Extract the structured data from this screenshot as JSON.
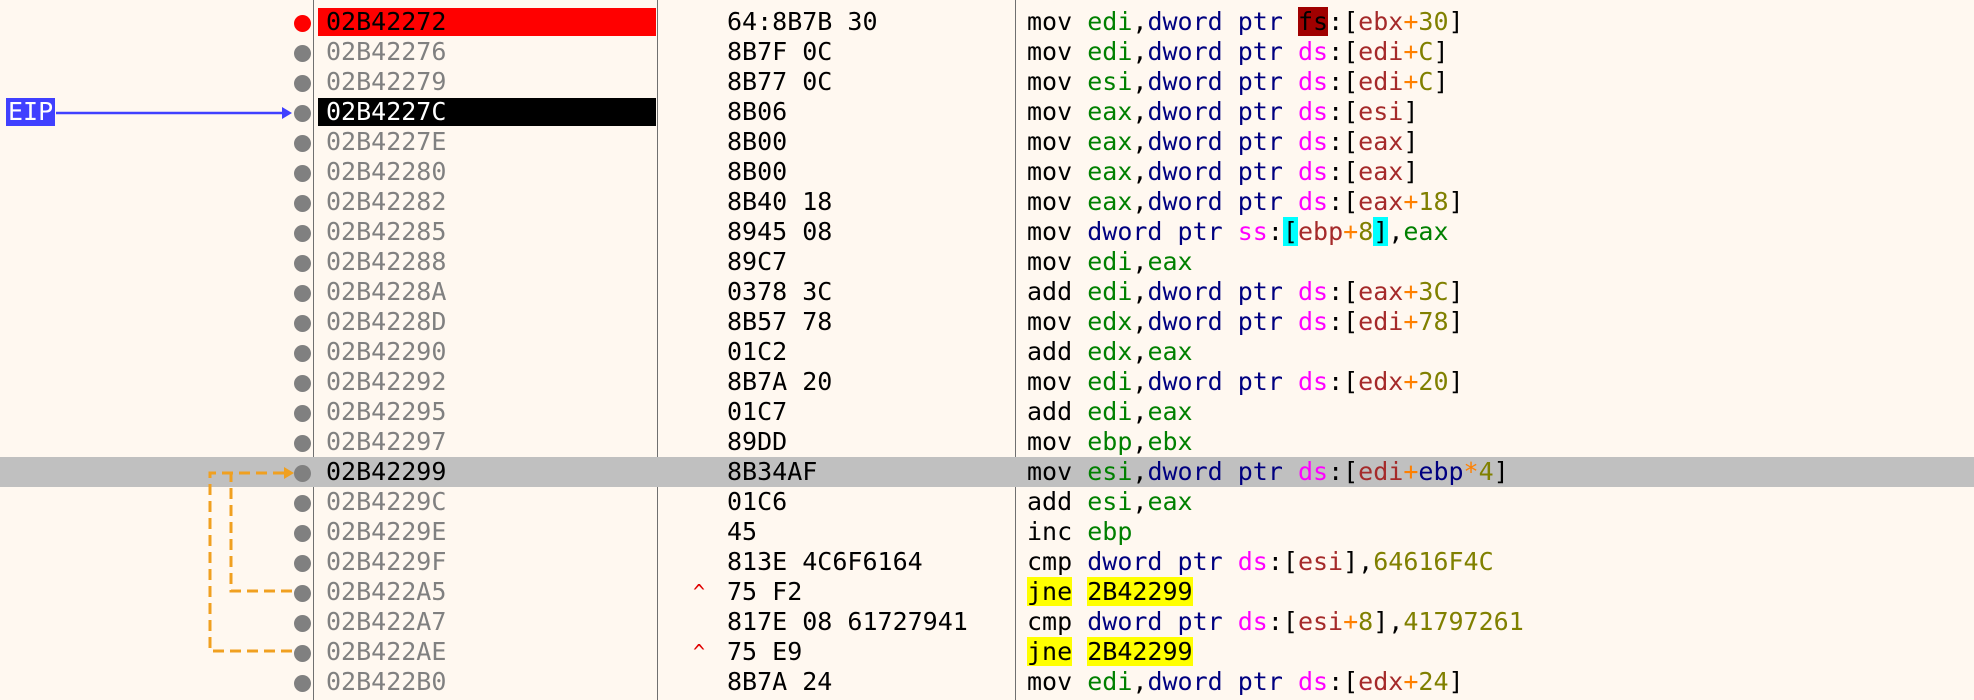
{
  "eip": {
    "label": "EIP"
  },
  "rows": [
    {
      "addr": "02B42272",
      "bytes": "64:8B7B 30",
      "state": "breakpoint",
      "instr": [
        [
          "mn",
          "mov "
        ],
        [
          "reg",
          "edi"
        ],
        [
          "br",
          ","
        ],
        [
          "kw",
          "dword ptr "
        ],
        [
          "seg",
          "fs",
          "rb"
        ],
        [
          "br",
          ":["
        ],
        [
          "mreg",
          "ebx"
        ],
        [
          "op",
          "+"
        ],
        [
          "imm",
          "30"
        ],
        [
          "br",
          "]"
        ]
      ]
    },
    {
      "addr": "02B42276",
      "bytes": "8B7F 0C",
      "instr": [
        [
          "mn",
          "mov "
        ],
        [
          "reg",
          "edi"
        ],
        [
          "br",
          ","
        ],
        [
          "kw",
          "dword ptr "
        ],
        [
          "seg",
          "ds"
        ],
        [
          "br",
          ":["
        ],
        [
          "mreg",
          "edi"
        ],
        [
          "op",
          "+"
        ],
        [
          "imm",
          "C"
        ],
        [
          "br",
          "]"
        ]
      ]
    },
    {
      "addr": "02B42279",
      "bytes": "8B77 0C",
      "instr": [
        [
          "mn",
          "mov "
        ],
        [
          "reg",
          "esi"
        ],
        [
          "br",
          ","
        ],
        [
          "kw",
          "dword ptr "
        ],
        [
          "seg",
          "ds"
        ],
        [
          "br",
          ":["
        ],
        [
          "mreg",
          "edi"
        ],
        [
          "op",
          "+"
        ],
        [
          "imm",
          "C"
        ],
        [
          "br",
          "]"
        ]
      ]
    },
    {
      "addr": "02B4227C",
      "bytes": "8B06",
      "state": "eip",
      "instr": [
        [
          "mn",
          "mov "
        ],
        [
          "reg",
          "eax"
        ],
        [
          "br",
          ","
        ],
        [
          "kw",
          "dword ptr "
        ],
        [
          "seg",
          "ds"
        ],
        [
          "br",
          ":["
        ],
        [
          "mreg",
          "esi"
        ],
        [
          "br",
          "]"
        ]
      ]
    },
    {
      "addr": "02B4227E",
      "bytes": "8B00",
      "instr": [
        [
          "mn",
          "mov "
        ],
        [
          "reg",
          "eax"
        ],
        [
          "br",
          ","
        ],
        [
          "kw",
          "dword ptr "
        ],
        [
          "seg",
          "ds"
        ],
        [
          "br",
          ":["
        ],
        [
          "mreg",
          "eax"
        ],
        [
          "br",
          "]"
        ]
      ]
    },
    {
      "addr": "02B42280",
      "bytes": "8B00",
      "instr": [
        [
          "mn",
          "mov "
        ],
        [
          "reg",
          "eax"
        ],
        [
          "br",
          ","
        ],
        [
          "kw",
          "dword ptr "
        ],
        [
          "seg",
          "ds"
        ],
        [
          "br",
          ":["
        ],
        [
          "mreg",
          "eax"
        ],
        [
          "br",
          "]"
        ]
      ]
    },
    {
      "addr": "02B42282",
      "bytes": "8B40 18",
      "instr": [
        [
          "mn",
          "mov "
        ],
        [
          "reg",
          "eax"
        ],
        [
          "br",
          ","
        ],
        [
          "kw",
          "dword ptr "
        ],
        [
          "seg",
          "ds"
        ],
        [
          "br",
          ":["
        ],
        [
          "mreg",
          "eax"
        ],
        [
          "op",
          "+"
        ],
        [
          "imm",
          "18"
        ],
        [
          "br",
          "]"
        ]
      ]
    },
    {
      "addr": "02B42285",
      "bytes": "8945 08",
      "instr": [
        [
          "mn",
          "mov "
        ],
        [
          "kw",
          "dword ptr "
        ],
        [
          "seg",
          "ss"
        ],
        [
          "br",
          ":"
        ],
        [
          "br",
          "[",
          "cy"
        ],
        [
          "mreg",
          "ebp"
        ],
        [
          "op",
          "+"
        ],
        [
          "imm",
          "8"
        ],
        [
          "br",
          "]",
          "cy"
        ],
        [
          "br",
          ","
        ],
        [
          "reg",
          "eax"
        ]
      ]
    },
    {
      "addr": "02B42288",
      "bytes": "89C7",
      "instr": [
        [
          "mn",
          "mov "
        ],
        [
          "reg",
          "edi"
        ],
        [
          "br",
          ","
        ],
        [
          "reg",
          "eax"
        ]
      ]
    },
    {
      "addr": "02B4228A",
      "bytes": "0378 3C",
      "instr": [
        [
          "mn",
          "add "
        ],
        [
          "reg",
          "edi"
        ],
        [
          "br",
          ","
        ],
        [
          "kw",
          "dword ptr "
        ],
        [
          "seg",
          "ds"
        ],
        [
          "br",
          ":["
        ],
        [
          "mreg",
          "eax"
        ],
        [
          "op",
          "+"
        ],
        [
          "imm",
          "3C"
        ],
        [
          "br",
          "]"
        ]
      ]
    },
    {
      "addr": "02B4228D",
      "bytes": "8B57 78",
      "instr": [
        [
          "mn",
          "mov "
        ],
        [
          "reg",
          "edx"
        ],
        [
          "br",
          ","
        ],
        [
          "kw",
          "dword ptr "
        ],
        [
          "seg",
          "ds"
        ],
        [
          "br",
          ":["
        ],
        [
          "mreg",
          "edi"
        ],
        [
          "op",
          "+"
        ],
        [
          "imm",
          "78"
        ],
        [
          "br",
          "]"
        ]
      ]
    },
    {
      "addr": "02B42290",
      "bytes": "01C2",
      "instr": [
        [
          "mn",
          "add "
        ],
        [
          "reg",
          "edx"
        ],
        [
          "br",
          ","
        ],
        [
          "reg",
          "eax"
        ]
      ]
    },
    {
      "addr": "02B42292",
      "bytes": "8B7A 20",
      "instr": [
        [
          "mn",
          "mov "
        ],
        [
          "reg",
          "edi"
        ],
        [
          "br",
          ","
        ],
        [
          "kw",
          "dword ptr "
        ],
        [
          "seg",
          "ds"
        ],
        [
          "br",
          ":["
        ],
        [
          "mreg",
          "edx"
        ],
        [
          "op",
          "+"
        ],
        [
          "imm",
          "20"
        ],
        [
          "br",
          "]"
        ]
      ]
    },
    {
      "addr": "02B42295",
      "bytes": "01C7",
      "instr": [
        [
          "mn",
          "add "
        ],
        [
          "reg",
          "edi"
        ],
        [
          "br",
          ","
        ],
        [
          "reg",
          "eax"
        ]
      ]
    },
    {
      "addr": "02B42297",
      "bytes": "89DD",
      "instr": [
        [
          "mn",
          "mov "
        ],
        [
          "reg",
          "ebp"
        ],
        [
          "br",
          ","
        ],
        [
          "reg",
          "ebx"
        ]
      ]
    },
    {
      "addr": "02B42299",
      "bytes": "8B34AF",
      "state": "selected",
      "instr": [
        [
          "mn",
          "mov "
        ],
        [
          "reg",
          "esi"
        ],
        [
          "br",
          ","
        ],
        [
          "kw",
          "dword ptr "
        ],
        [
          "seg",
          "ds"
        ],
        [
          "br",
          ":["
        ],
        [
          "mreg",
          "edi"
        ],
        [
          "op",
          "+"
        ],
        [
          "kw",
          "ebp"
        ],
        [
          "op",
          "*"
        ],
        [
          "imm",
          "4"
        ],
        [
          "br",
          "]"
        ]
      ]
    },
    {
      "addr": "02B4229C",
      "bytes": "01C6",
      "instr": [
        [
          "mn",
          "add "
        ],
        [
          "reg",
          "esi"
        ],
        [
          "br",
          ","
        ],
        [
          "reg",
          "eax"
        ]
      ]
    },
    {
      "addr": "02B4229E",
      "bytes": "45",
      "instr": [
        [
          "mn",
          "inc "
        ],
        [
          "reg",
          "ebp"
        ]
      ]
    },
    {
      "addr": "02B4229F",
      "bytes": "813E 4C6F6164",
      "instr": [
        [
          "mn",
          "cmp "
        ],
        [
          "kw",
          "dword ptr "
        ],
        [
          "seg",
          "ds"
        ],
        [
          "br",
          ":["
        ],
        [
          "mreg",
          "esi"
        ],
        [
          "br",
          "],"
        ],
        [
          "imm",
          "64616F4C"
        ]
      ]
    },
    {
      "addr": "02B422A5",
      "bytes": "75 F2",
      "jmp_mark": "^",
      "instr": [
        [
          "mn",
          "jne",
          "yl"
        ],
        [
          "br",
          " "
        ],
        [
          "mn",
          "2B42299",
          "yl"
        ]
      ]
    },
    {
      "addr": "02B422A7",
      "bytes": "817E 08 61727941",
      "instr": [
        [
          "mn",
          "cmp "
        ],
        [
          "kw",
          "dword ptr "
        ],
        [
          "seg",
          "ds"
        ],
        [
          "br",
          ":["
        ],
        [
          "mreg",
          "esi"
        ],
        [
          "op",
          "+"
        ],
        [
          "imm",
          "8"
        ],
        [
          "br",
          "],"
        ],
        [
          "imm",
          "41797261"
        ]
      ]
    },
    {
      "addr": "02B422AE",
      "bytes": "75 E9",
      "jmp_mark": "^",
      "instr": [
        [
          "mn",
          "jne",
          "yl"
        ],
        [
          "br",
          " "
        ],
        [
          "mn",
          "2B42299",
          "yl"
        ]
      ]
    },
    {
      "addr": "02B422B0",
      "bytes": "8B7A 24",
      "instr": [
        [
          "mn",
          "mov "
        ],
        [
          "reg",
          "edi"
        ],
        [
          "br",
          ","
        ],
        [
          "kw",
          "dword ptr "
        ],
        [
          "seg",
          "ds"
        ],
        [
          "br",
          ":["
        ],
        [
          "mreg",
          "edx"
        ],
        [
          "op",
          "+"
        ],
        [
          "imm",
          "24"
        ],
        [
          "br",
          "]"
        ]
      ]
    }
  ],
  "colors": {
    "background": "#fff8f0",
    "breakpoint": "#ff0000",
    "eip_arrow": "#4040ff",
    "jump_arrow": "#f0a020",
    "selection": "#c0c0c0"
  }
}
